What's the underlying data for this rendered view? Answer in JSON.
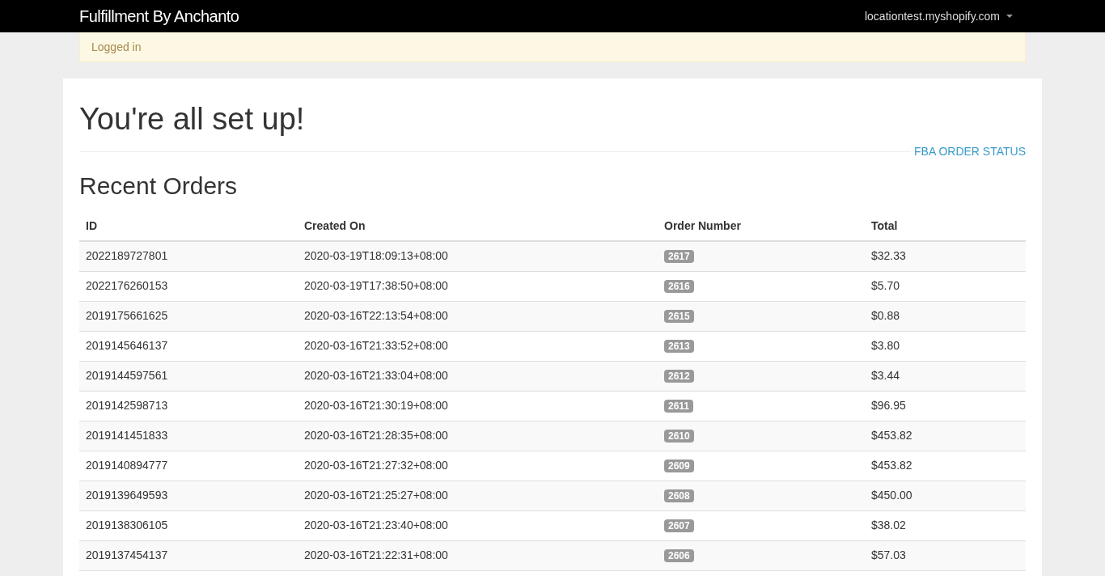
{
  "navbar": {
    "brand": "Fulfillment By Anchanto",
    "account": "locationtest.myshopify.com"
  },
  "alert": "Logged in",
  "heading": "You're all set up!",
  "status_link": "FBA ORDER STATUS",
  "section_title": "Recent Orders",
  "table": {
    "columns": [
      "ID",
      "Created On",
      "Order Number",
      "Total"
    ],
    "rows": [
      {
        "id": "2022189727801",
        "created_on": "2020-03-19T18:09:13+08:00",
        "order_number": "2617",
        "total": "$32.33"
      },
      {
        "id": "2022176260153",
        "created_on": "2020-03-19T17:38:50+08:00",
        "order_number": "2616",
        "total": "$5.70"
      },
      {
        "id": "2019175661625",
        "created_on": "2020-03-16T22:13:54+08:00",
        "order_number": "2615",
        "total": "$0.88"
      },
      {
        "id": "2019145646137",
        "created_on": "2020-03-16T21:33:52+08:00",
        "order_number": "2613",
        "total": "$3.80"
      },
      {
        "id": "2019144597561",
        "created_on": "2020-03-16T21:33:04+08:00",
        "order_number": "2612",
        "total": "$3.44"
      },
      {
        "id": "2019142598713",
        "created_on": "2020-03-16T21:30:19+08:00",
        "order_number": "2611",
        "total": "$96.95"
      },
      {
        "id": "2019141451833",
        "created_on": "2020-03-16T21:28:35+08:00",
        "order_number": "2610",
        "total": "$453.82"
      },
      {
        "id": "2019140894777",
        "created_on": "2020-03-16T21:27:32+08:00",
        "order_number": "2609",
        "total": "$453.82"
      },
      {
        "id": "2019139649593",
        "created_on": "2020-03-16T21:25:27+08:00",
        "order_number": "2608",
        "total": "$450.00"
      },
      {
        "id": "2019138306105",
        "created_on": "2020-03-16T21:23:40+08:00",
        "order_number": "2607",
        "total": "$38.02"
      },
      {
        "id": "2019137454137",
        "created_on": "2020-03-16T21:22:31+08:00",
        "order_number": "2606",
        "total": "$57.03"
      }
    ]
  }
}
